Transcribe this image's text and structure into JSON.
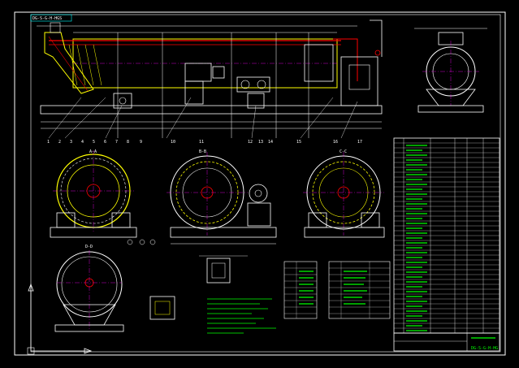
{
  "drawing": {
    "title_code": "DG-S-G-H-HGS",
    "section_labels": [
      "A-A",
      "B-B",
      "C-C",
      "D-D"
    ],
    "bottom_labels": [
      "1",
      "2",
      "3",
      "4",
      "5",
      "6",
      "7",
      "8",
      "9",
      "10",
      "11",
      "12",
      "13",
      "14",
      "15",
      "16",
      "17"
    ],
    "colors": {
      "background": "#000000",
      "outline": "#ffffff",
      "body": "#ffff00",
      "accent": "#ff0000",
      "dimension": "#00ff00",
      "centerline": "#ff00ff",
      "table": "#00ffff"
    },
    "title_block_code": "DG-S-G-H-HG"
  }
}
